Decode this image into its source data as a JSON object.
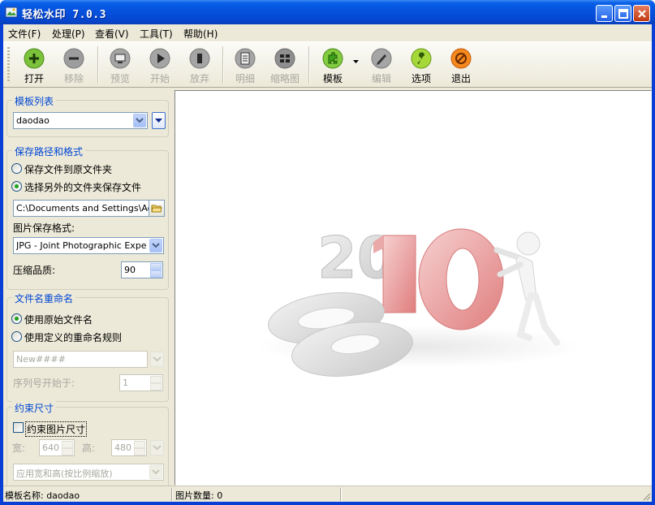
{
  "window": {
    "title": "轻松水印 7.0.3"
  },
  "menu": {
    "items": [
      "文件(F)",
      "处理(P)",
      "查看(V)",
      "工具(T)",
      "帮助(H)"
    ]
  },
  "toolbar": {
    "open": "打开",
    "remove": "移除",
    "preview": "预览",
    "start": "开始",
    "abort": "放弃",
    "detail": "明细",
    "thumbnail": "缩略图",
    "template": "模板",
    "edit": "编辑",
    "options": "选项",
    "exit": "退出"
  },
  "template_list": {
    "title": "模板列表",
    "selected": "daodao"
  },
  "save": {
    "title": "保存路径和格式",
    "option_original": "保存文件到原文件夹",
    "option_other": "选择另外的文件夹保存文件",
    "path": "C:\\Documents and Settings\\Adm",
    "format_label": "图片保存格式:",
    "format_value": "JPG - Joint Photographic Experts G",
    "quality_label": "压缩品质:",
    "quality_value": "90"
  },
  "rename": {
    "title": "文件名重命名",
    "option_original": "使用原始文件名",
    "option_custom": "使用定义的重命名规则",
    "pattern": "New####",
    "seq_label": "序列号开始于:",
    "seq_value": "1"
  },
  "resize": {
    "title": "约束尺寸",
    "checkbox_label": "约束图片尺寸",
    "width_label": "宽:",
    "width_value": "640",
    "height_label": "高:",
    "height_value": "480",
    "mode": "应用宽和高(按比例缩放)"
  },
  "status": {
    "template_name": "模板名称: daodao",
    "image_count": "图片数量: 0"
  },
  "colors": {
    "group_title": "#0046d5",
    "titlebar": "#0554e0"
  }
}
